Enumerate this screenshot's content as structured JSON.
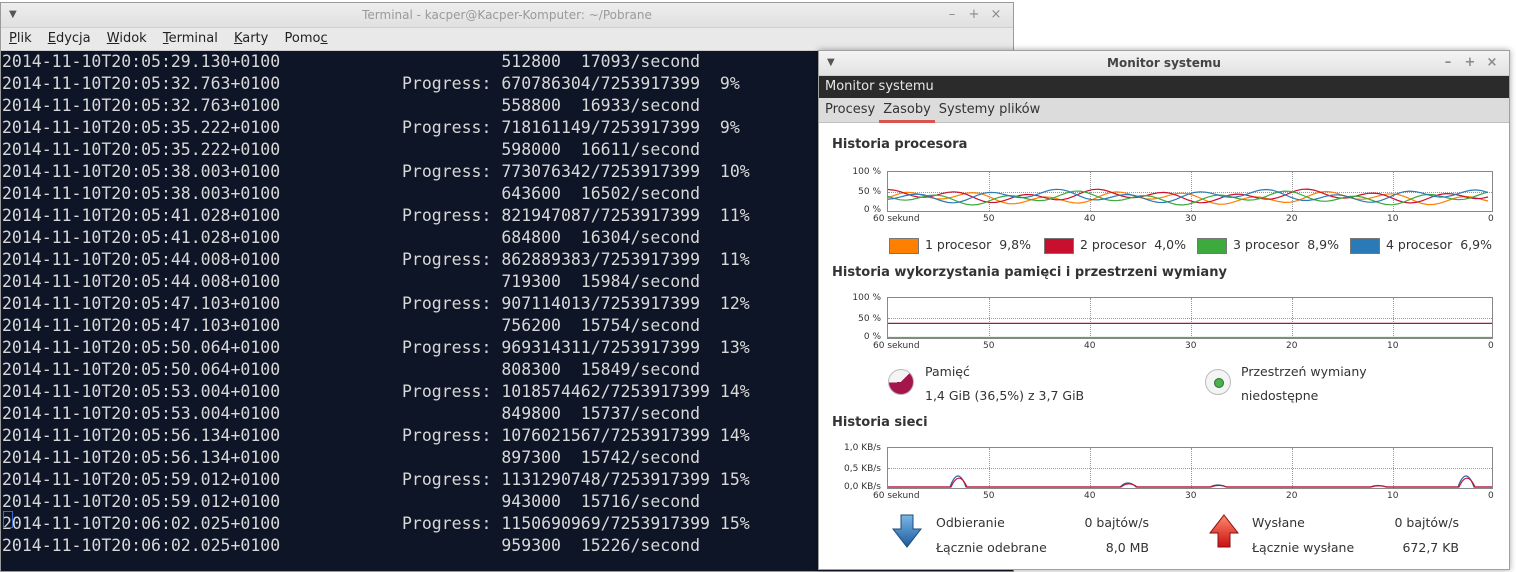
{
  "terminal": {
    "title": "Terminal - kacper@Kacper-Komputer: ~/Pobrane",
    "menu": [
      {
        "pre": "",
        "u": "P",
        "post": "lik"
      },
      {
        "pre": "",
        "u": "E",
        "post": "dycja"
      },
      {
        "pre": "",
        "u": "W",
        "post": "idok"
      },
      {
        "pre": "",
        "u": "T",
        "post": "erminal"
      },
      {
        "pre": "",
        "u": "K",
        "post": "arty"
      },
      {
        "pre": "Pomo",
        "u": "c",
        "post": ""
      }
    ],
    "lines": [
      {
        "ts": "2014-11-10T20:05:29.130+0100",
        "msg": "          512800  17093/second"
      },
      {
        "ts": "2014-11-10T20:05:32.763+0100",
        "msg": "Progress: 670786304/7253917399  9%"
      },
      {
        "ts": "2014-11-10T20:05:32.763+0100",
        "msg": "          558800  16933/second"
      },
      {
        "ts": "2014-11-10T20:05:35.222+0100",
        "msg": "Progress: 718161149/7253917399  9%"
      },
      {
        "ts": "2014-11-10T20:05:35.222+0100",
        "msg": "          598000  16611/second"
      },
      {
        "ts": "2014-11-10T20:05:38.003+0100",
        "msg": "Progress: 773076342/7253917399  10%"
      },
      {
        "ts": "2014-11-10T20:05:38.003+0100",
        "msg": "          643600  16502/second"
      },
      {
        "ts": "2014-11-10T20:05:41.028+0100",
        "msg": "Progress: 821947087/7253917399  11%"
      },
      {
        "ts": "2014-11-10T20:05:41.028+0100",
        "msg": "          684800  16304/second"
      },
      {
        "ts": "2014-11-10T20:05:44.008+0100",
        "msg": "Progress: 862889383/7253917399  11%"
      },
      {
        "ts": "2014-11-10T20:05:44.008+0100",
        "msg": "          719300  15984/second"
      },
      {
        "ts": "2014-11-10T20:05:47.103+0100",
        "msg": "Progress: 907114013/7253917399  12%"
      },
      {
        "ts": "2014-11-10T20:05:47.103+0100",
        "msg": "          756200  15754/second"
      },
      {
        "ts": "2014-11-10T20:05:50.064+0100",
        "msg": "Progress: 969314311/7253917399  13%"
      },
      {
        "ts": "2014-11-10T20:05:50.064+0100",
        "msg": "          808300  15849/second"
      },
      {
        "ts": "2014-11-10T20:05:53.004+0100",
        "msg": "Progress: 1018574462/7253917399 14%"
      },
      {
        "ts": "2014-11-10T20:05:53.004+0100",
        "msg": "          849800  15737/second"
      },
      {
        "ts": "2014-11-10T20:05:56.134+0100",
        "msg": "Progress: 1076021567/7253917399 14%"
      },
      {
        "ts": "2014-11-10T20:05:56.134+0100",
        "msg": "          897300  15742/second"
      },
      {
        "ts": "2014-11-10T20:05:59.012+0100",
        "msg": "Progress: 1131290748/7253917399 15%"
      },
      {
        "ts": "2014-11-10T20:05:59.012+0100",
        "msg": "          943000  15716/second"
      },
      {
        "ts": "2014-11-10T20:06:02.025+0100",
        "msg": "Progress: 1150690969/7253917399 15%"
      },
      {
        "ts": "2014-11-10T20:06:02.025+0100",
        "msg": "          959300  15226/second"
      }
    ]
  },
  "window_buttons": {
    "minimize": "–",
    "maximize": "+",
    "close": "×"
  },
  "monitor": {
    "title": "Monitor systemu",
    "header": "Monitor systemu",
    "tabs": [
      "Procesy",
      "Zasoby",
      "Systemy plików"
    ],
    "active_tab": 1,
    "x_labels": [
      "60 sekund",
      "50",
      "40",
      "30",
      "20",
      "10",
      "0"
    ],
    "cpu": {
      "title": "Historia procesora",
      "y_labels": [
        "100 %",
        "50 %",
        "0 %"
      ],
      "legend": [
        {
          "name": "1 procesor",
          "value": "9,8%",
          "color": "#ff7f00"
        },
        {
          "name": "2 procesor",
          "value": "4,0%",
          "color": "#c8102e"
        },
        {
          "name": "3 procesor",
          "value": "8,9%",
          "color": "#3caa3c"
        },
        {
          "name": "4 procesor",
          "value": "6,9%",
          "color": "#2a7ab8"
        }
      ]
    },
    "memory": {
      "title": "Historia wykorzystania pamięci i przestrzeni wymiany",
      "y_labels": [
        "100 %",
        "50 %",
        "0 %"
      ],
      "mem_label": "Pamięć",
      "mem_value": "1,4 GiB (36,5%) z 3,7 GiB",
      "mem_fraction": 0.365,
      "mem_color": "#a3154b",
      "swap_label": "Przestrzeń wymiany",
      "swap_value": "niedostępne",
      "swap_color": "#4caf50"
    },
    "network": {
      "title": "Historia sieci",
      "y_labels": [
        "1,0 KB/s",
        "0,5 KB/s",
        "0,0 KB/s"
      ],
      "recv_label": "Odbieranie",
      "recv_rate": "0 bajtów/s",
      "recv_total_label": "Łącznie odebrane",
      "recv_total": "8,0 MB",
      "sent_label": "Wysłane",
      "sent_rate": "0 bajtów/s",
      "sent_total_label": "Łącznie wysłane",
      "sent_total": "672,7 KB"
    }
  }
}
